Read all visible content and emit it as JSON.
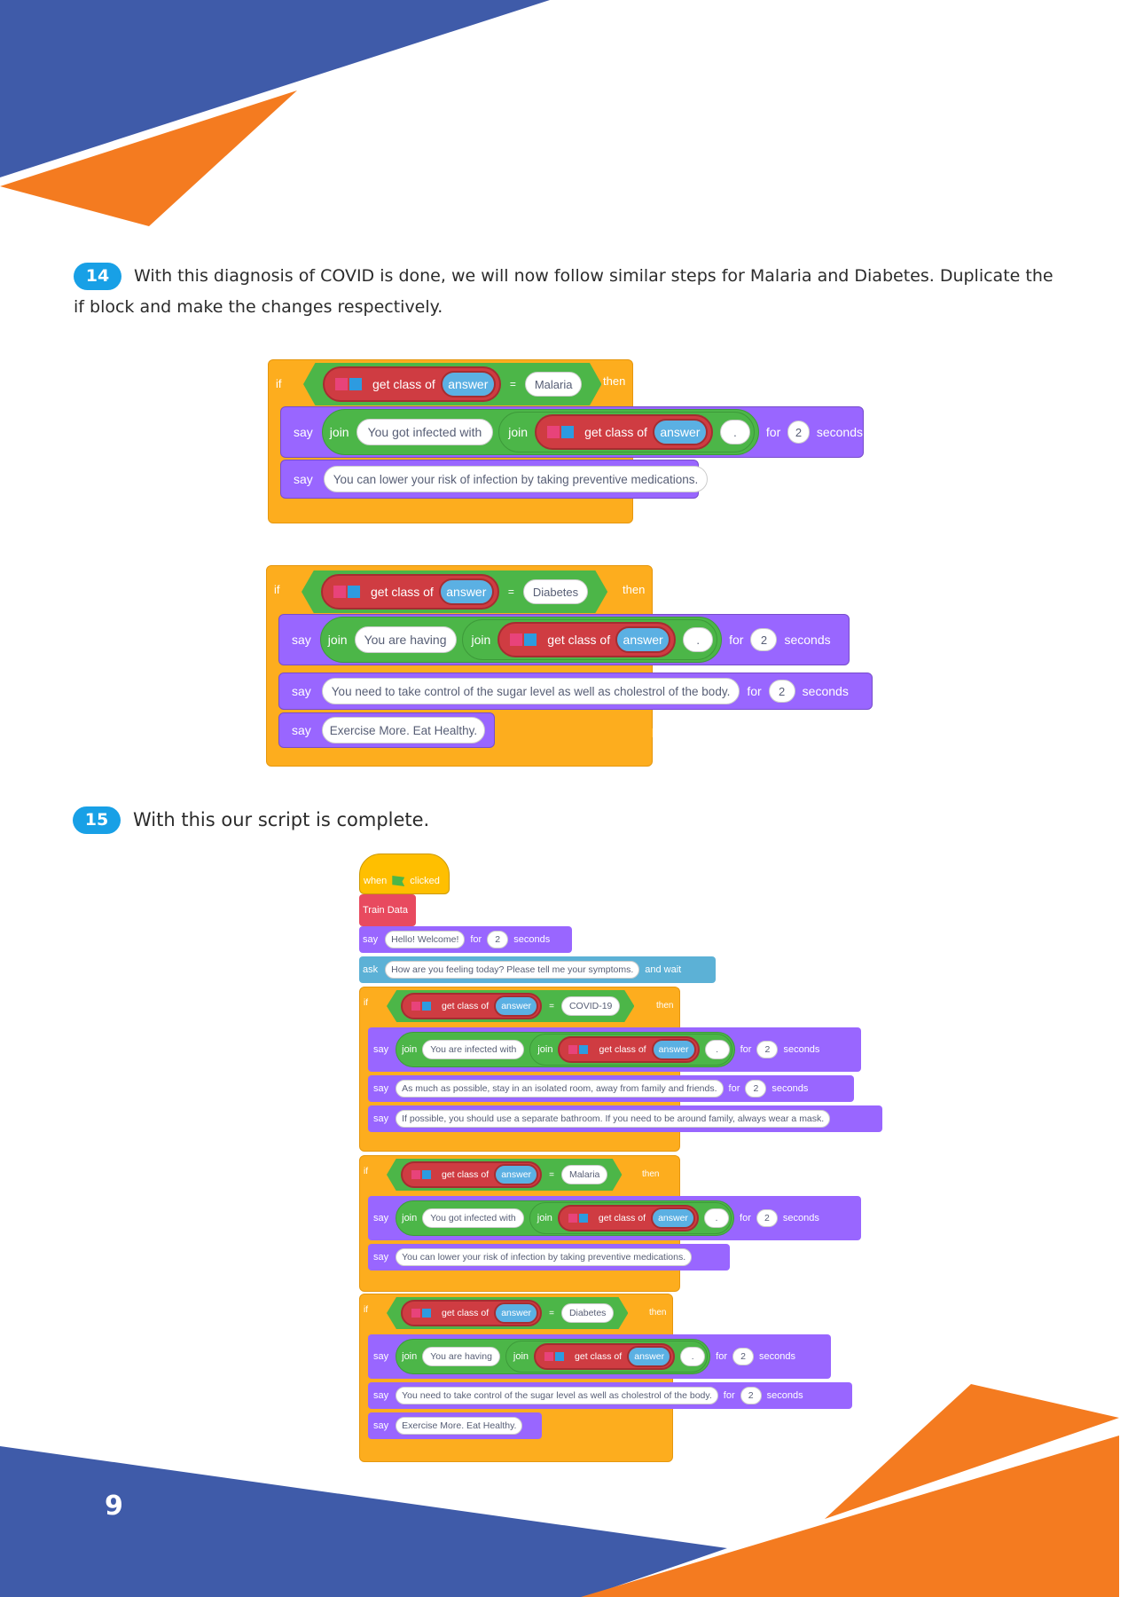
{
  "page_number": "9",
  "steps": [
    {
      "number": "14",
      "text": "With this diagnosis of COVID is done, we will now follow similar steps for Malaria and Diabetes. Duplicate the if block and make the changes respectively."
    },
    {
      "number": "15",
      "text": "With this our script is complete."
    }
  ],
  "blocks": {
    "if": "if",
    "then": "then",
    "say": "say",
    "join": "join",
    "for": "for",
    "seconds": "seconds",
    "eq": "=",
    "get_class_of": "get class of",
    "answer": "answer",
    "period": ".",
    "when": "when",
    "clicked": "clicked",
    "train_data": "Train Data",
    "ask": "ask",
    "and_wait": "and wait",
    "two": "2"
  },
  "script_malaria": {
    "class": "Malaria",
    "msg1": "You got infected with",
    "msg2": "You can lower your risk of infection by taking preventive medications."
  },
  "script_diabetes": {
    "class": "Diabetes",
    "msg1": "You are having",
    "msg2": "You need to take control of the sugar level as well as cholestrol of the body.",
    "msg3": "Exercise More. Eat Healthy."
  },
  "script_full": {
    "hello": "Hello! Welcome!",
    "question": "How are you feeling today? Please tell me your symptoms.",
    "covid_class": "COVID-19",
    "covid_msg1": "You are infected with",
    "covid_msg2": "As much as possible, stay in an isolated room, away from family and friends.",
    "covid_msg3": "If possible, you should use a separate bathroom. If you need to be around family,  always wear a mask."
  },
  "colors": {
    "navy": "#3f5ba9",
    "orange": "#f47b20",
    "badge": "#18a0e6"
  }
}
